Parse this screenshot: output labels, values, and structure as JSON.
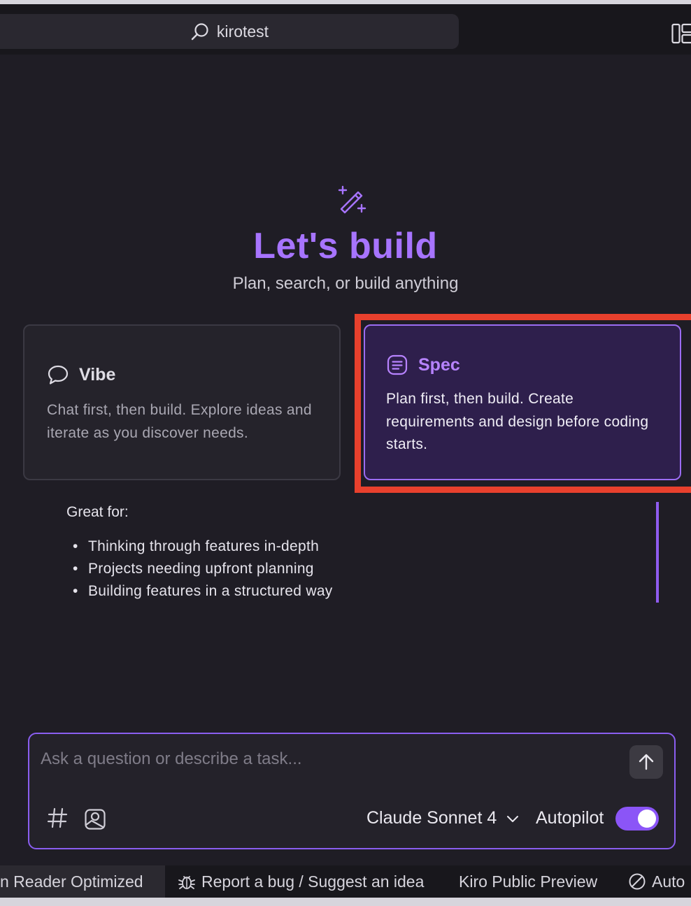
{
  "window": {
    "search_text": "kirotest"
  },
  "hero": {
    "title": "Let's build",
    "subtitle": "Plan, search, or build anything"
  },
  "modes": {
    "vibe": {
      "title": "Vibe",
      "description": "Chat first, then build. Explore ideas and iterate as you discover needs."
    },
    "spec": {
      "title": "Spec",
      "description": "Plan first, then build. Create requirements and design before coding starts."
    }
  },
  "great_for": {
    "title": "Great for:",
    "items": [
      "Thinking through features in-depth",
      "Projects needing upfront planning",
      "Building features in a structured way"
    ]
  },
  "chat": {
    "placeholder": "Ask a question or describe a task...",
    "model": "Claude Sonnet 4",
    "autopilot_label": "Autopilot",
    "autopilot_on": true
  },
  "statusbar": {
    "screen_reader": "n Reader Optimized",
    "report_bug": "Report a bug / Suggest an idea",
    "preview": "Kiro Public Preview",
    "auto": "Auto"
  },
  "colors": {
    "accent": "#a774ff",
    "highlight_box": "#e8402d",
    "background": "#1f1d25"
  }
}
